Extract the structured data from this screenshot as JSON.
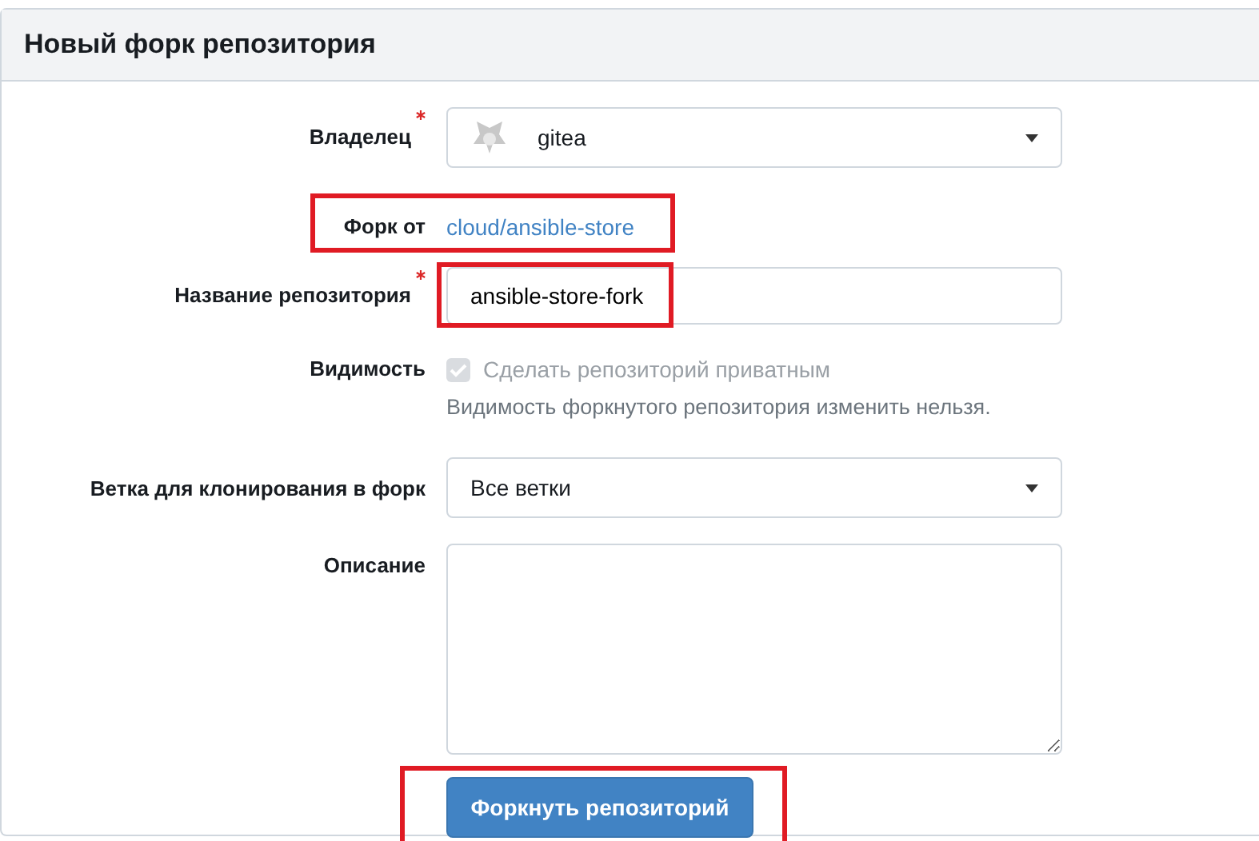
{
  "header": {
    "title": "Новый форк репозитория"
  },
  "form": {
    "owner": {
      "label": "Владелец",
      "required": true,
      "value": "gitea"
    },
    "fork_from": {
      "label": "Форк от",
      "link": "cloud/ansible-store",
      "highlighted": true
    },
    "repo_name": {
      "label": "Название репозитория",
      "required": true,
      "value": "ansible-store-fork",
      "highlighted": true
    },
    "visibility": {
      "label": "Видимость",
      "checkbox_label": "Сделать репозиторий приватным",
      "checked": true,
      "disabled": true,
      "hint": "Видимость форкнутого репозитория изменить нельзя."
    },
    "branch": {
      "label": "Ветка для клонирования в форк",
      "value": "Все ветки"
    },
    "description": {
      "label": "Описание"
    },
    "submit": {
      "label": "Форкнуть репозиторий",
      "highlighted": true
    }
  }
}
